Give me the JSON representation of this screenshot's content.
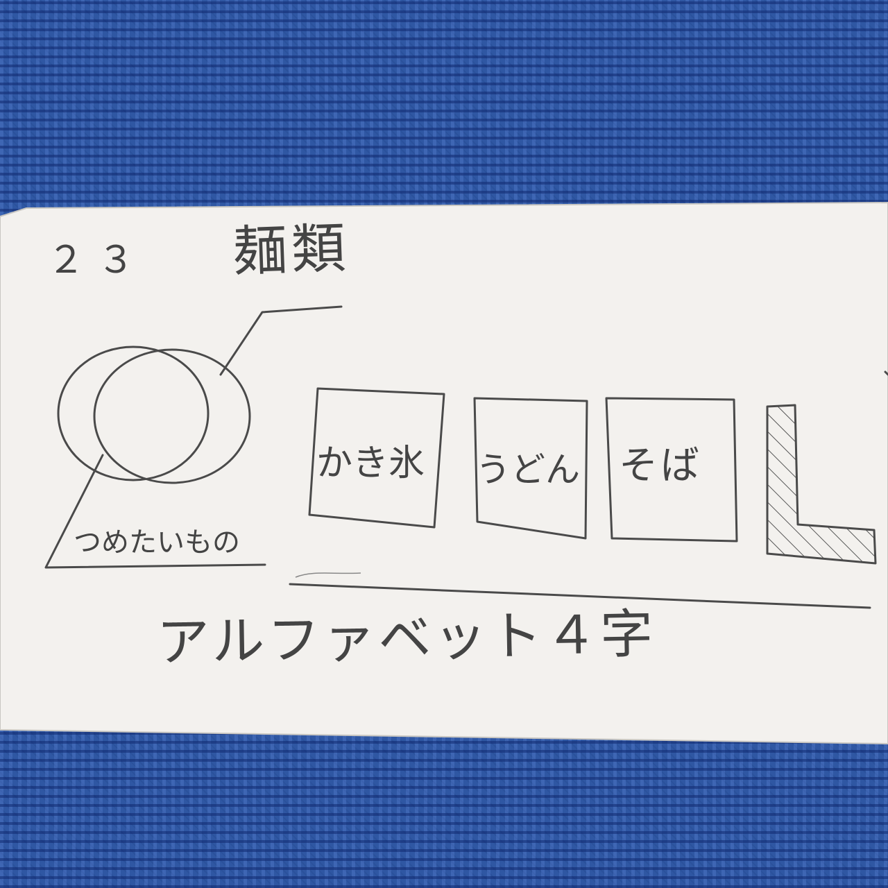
{
  "note": {
    "number": "２３",
    "title": "麺類",
    "circle_label": "つめたいもの",
    "boxes": [
      {
        "label": "かき氷"
      },
      {
        "label": "うどん"
      },
      {
        "label": "そば"
      }
    ],
    "bottom_text": "アルファベット４字"
  },
  "colors": {
    "background_fabric": "#2f57a3",
    "paper": "#f3f1ee",
    "pencil": "#4a4a4a"
  }
}
